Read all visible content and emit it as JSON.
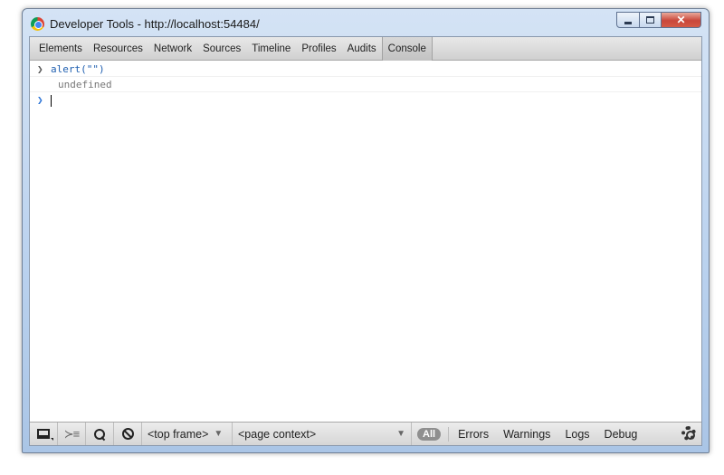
{
  "window": {
    "title": "Developer Tools - http://localhost:54484/"
  },
  "tabs": [
    {
      "label": "Elements"
    },
    {
      "label": "Resources"
    },
    {
      "label": "Network"
    },
    {
      "label": "Sources"
    },
    {
      "label": "Timeline"
    },
    {
      "label": "Profiles"
    },
    {
      "label": "Audits"
    },
    {
      "label": "Console",
      "active": true
    }
  ],
  "console": {
    "entries": [
      {
        "type": "command",
        "text": "alert(\"\")"
      },
      {
        "type": "result",
        "text": "undefined"
      }
    ],
    "input_value": ""
  },
  "statusbar": {
    "frame_select": "<top frame>",
    "context_select": "<page context>",
    "filters": {
      "all": "All",
      "errors": "Errors",
      "warnings": "Warnings",
      "logs": "Logs",
      "debug": "Debug"
    }
  },
  "icons": {
    "app": "chrome-logo-icon",
    "dock": "dock-icon",
    "execution_context": "show-console-icon",
    "search": "search-icon",
    "clear": "clear-console-icon",
    "settings": "gear-icon"
  },
  "colors": {
    "command_text": "#1f5fb0",
    "result_text": "#777777",
    "prompt_active": "#2a73d6",
    "close_button": "#c9463a"
  }
}
